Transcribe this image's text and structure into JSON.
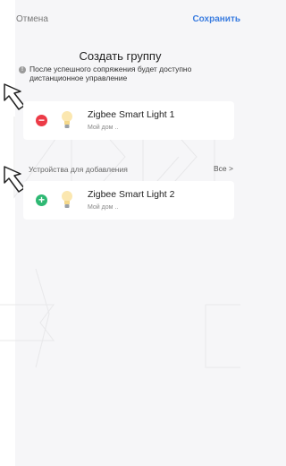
{
  "topbar": {
    "cancel_label": "Отмена",
    "save_label": "Сохранить"
  },
  "title": "Создать группу",
  "info": {
    "icon": "info-icon",
    "text": "После успешного сопряжения будет доступно дистанционное управление"
  },
  "group_devices": [
    {
      "name": "Zigbee Smart Light 1",
      "location": "Мой дом ..",
      "action": "remove"
    }
  ],
  "available_section": {
    "label": "Устройства для добавления",
    "all_label": "Все >"
  },
  "available_devices": [
    {
      "name": "Zigbee Smart Light 2",
      "location": "Мой дом ..",
      "action": "add"
    }
  ],
  "colors": {
    "accent": "#3b7de0",
    "remove": "#ec3b47",
    "add": "#2eb873"
  }
}
